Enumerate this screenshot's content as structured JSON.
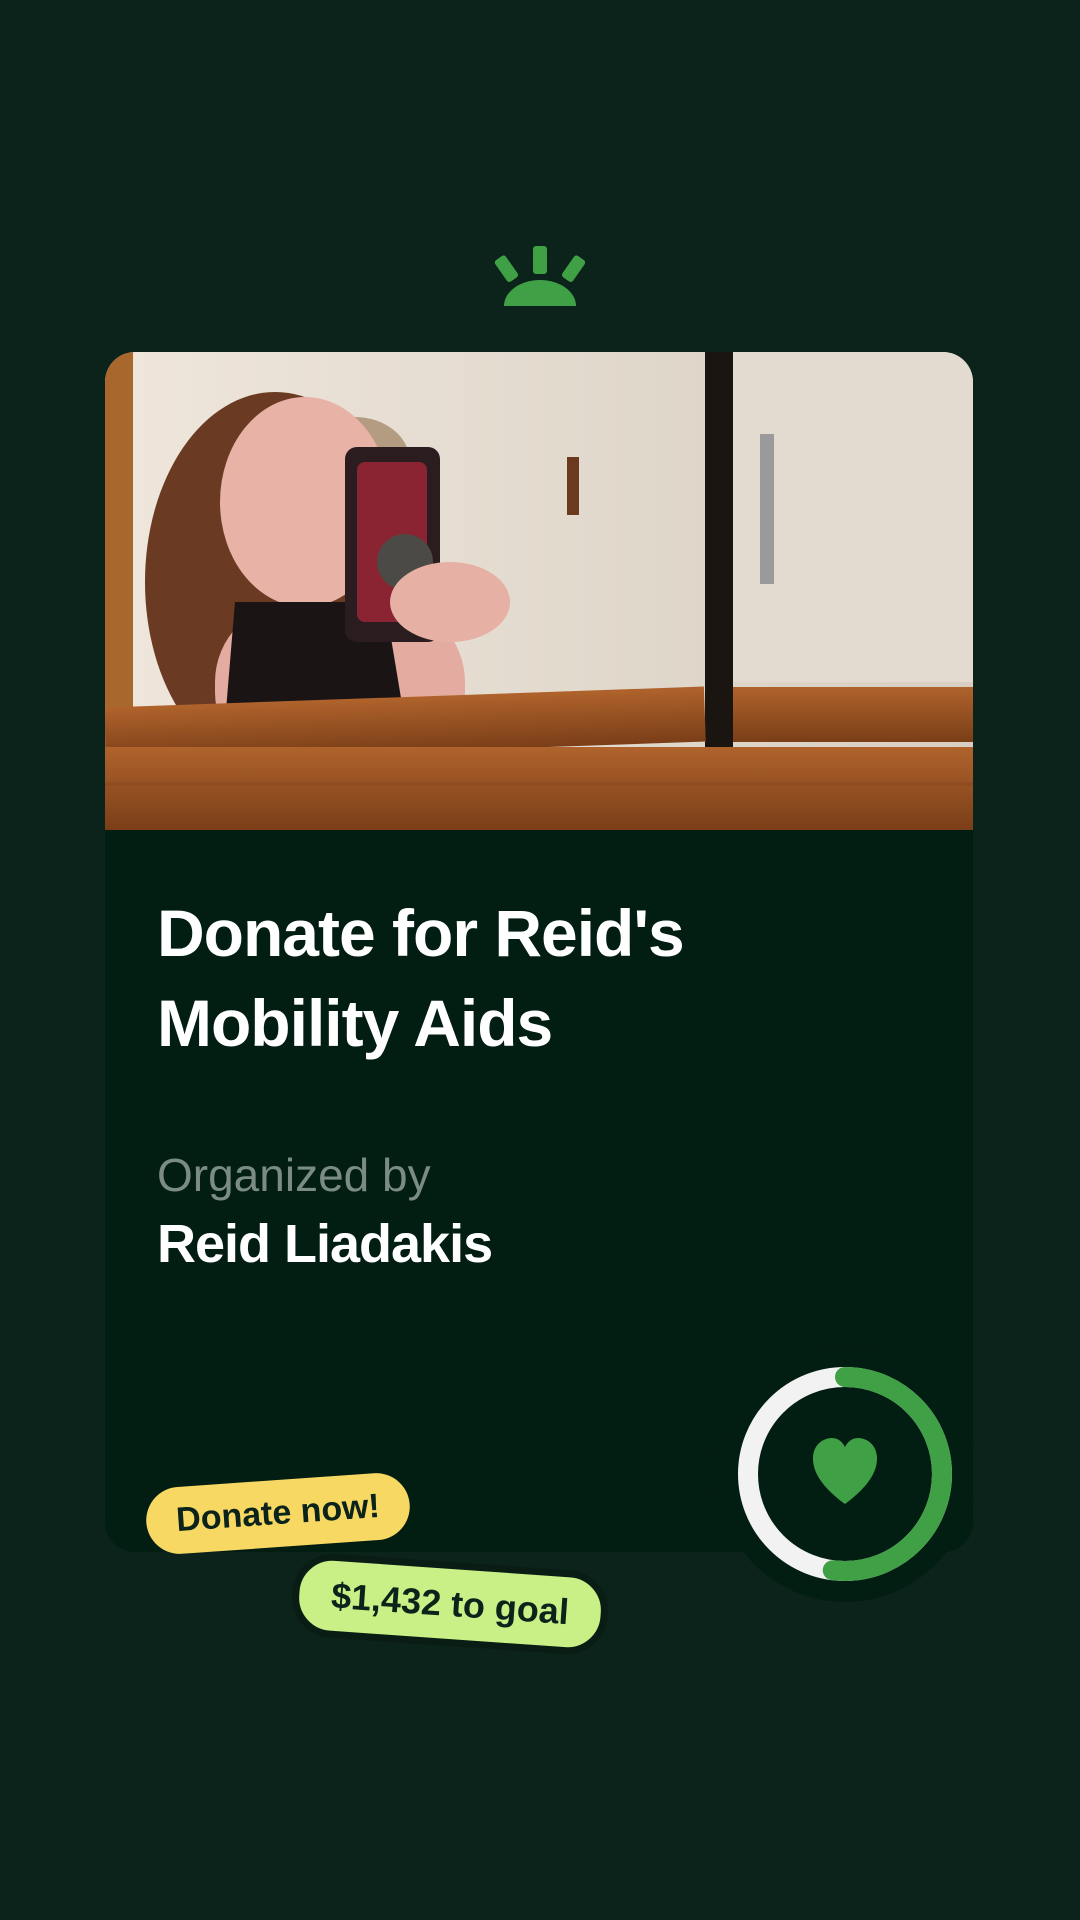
{
  "campaign": {
    "title": "Donate for Reid's Mobility Aids",
    "organized_label": "Organized by",
    "organizer_name": "Reid Liadakis"
  },
  "cta": {
    "donate_label": "Donate now!",
    "goal_remaining_label": "$1,432 to goal"
  },
  "progress": {
    "fraction_raised": 0.52
  },
  "icons": {
    "logo": "sunrise-logo-icon",
    "progress_center": "heart-icon"
  },
  "colors": {
    "background": "#0b231a",
    "card": "#021d12",
    "brand_green": "#3fa046",
    "donate_pill": "#f7d862",
    "goal_pill": "#c8f086"
  }
}
